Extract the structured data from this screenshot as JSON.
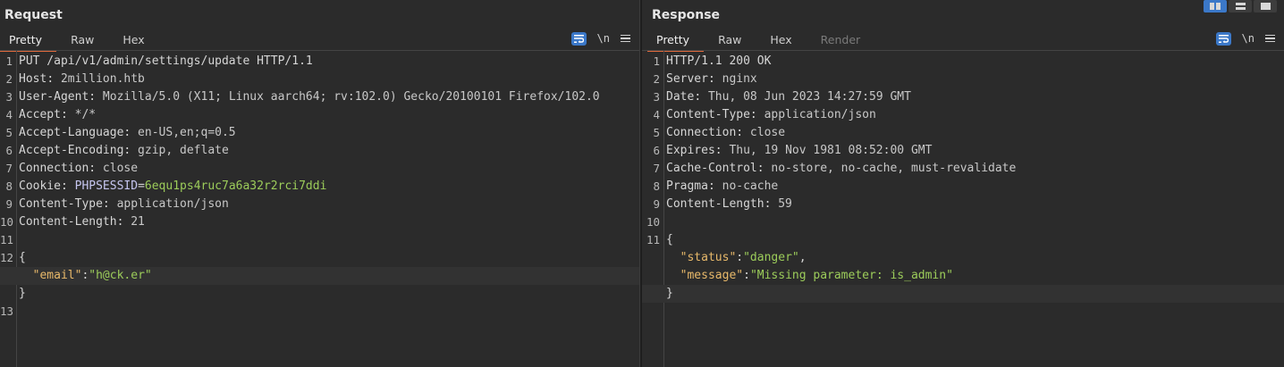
{
  "request": {
    "title": "Request",
    "tabs": [
      "Pretty",
      "Raw",
      "Hex"
    ],
    "toolbar": {
      "newline_label": "\\n"
    },
    "lines": [
      {
        "n": "1",
        "plain": "PUT /api/v1/admin/settings/update HTTP/1.1"
      },
      {
        "n": "2",
        "key": "Host",
        "val": " 2million.htb"
      },
      {
        "n": "3",
        "key": "User-Agent",
        "val": " Mozilla/5.0 (X11; Linux aarch64; rv:102.0) Gecko/20100101 Firefox/102.0"
      },
      {
        "n": "4",
        "key": "Accept",
        "val": " */*"
      },
      {
        "n": "5",
        "key": "Accept-Language",
        "val": " en-US,en;q=0.5"
      },
      {
        "n": "6",
        "key": "Accept-Encoding",
        "val": " gzip, deflate"
      },
      {
        "n": "7",
        "key": "Connection",
        "val": " close"
      },
      {
        "n": "8",
        "key": "Cookie",
        "cookie_name": "PHPSESSID",
        "cookie_value": "6equ1ps4ruc7a6a32r2rci7ddi"
      },
      {
        "n": "9",
        "key": "Content-Type",
        "val": " application/json"
      },
      {
        "n": "10",
        "key": "Content-Length",
        "val": " 21"
      },
      {
        "n": "11",
        "plain": ""
      },
      {
        "n": "12",
        "plain": "{"
      },
      {
        "n": "",
        "jkey": "\"email\"",
        "jval": "\"h@ck.er\"",
        "highlight": true,
        "indent": true
      },
      {
        "n": "",
        "plain": "}"
      },
      {
        "n": "13",
        "plain": ""
      }
    ]
  },
  "response": {
    "title": "Response",
    "tabs": [
      "Pretty",
      "Raw",
      "Hex",
      "Render"
    ],
    "toolbar": {
      "newline_label": "\\n"
    },
    "lines": [
      {
        "n": "1",
        "plain": "HTTP/1.1 200 OK"
      },
      {
        "n": "2",
        "key": "Server",
        "val": " nginx"
      },
      {
        "n": "3",
        "key": "Date",
        "val": " Thu, 08 Jun 2023 14:27:59 GMT"
      },
      {
        "n": "4",
        "key": "Content-Type",
        "val": " application/json"
      },
      {
        "n": "5",
        "key": "Connection",
        "val": " close"
      },
      {
        "n": "6",
        "key": "Expires",
        "val": " Thu, 19 Nov 1981 08:52:00 GMT"
      },
      {
        "n": "7",
        "key": "Cache-Control",
        "val": " no-store, no-cache, must-revalidate"
      },
      {
        "n": "8",
        "key": "Pragma",
        "val": " no-cache"
      },
      {
        "n": "9",
        "key": "Content-Length",
        "val": " 59"
      },
      {
        "n": "10",
        "plain": ""
      },
      {
        "n": "11",
        "plain": "{"
      },
      {
        "n": "",
        "jkey": "\"status\"",
        "jval": "\"danger\"",
        "trail": ",",
        "indent": true
      },
      {
        "n": "",
        "jkey": "\"message\"",
        "jval": "\"Missing parameter: is_admin\"",
        "indent": true
      },
      {
        "n": "",
        "plain": "}",
        "highlight": true
      }
    ]
  },
  "colors": {
    "accent": "#3b78c8",
    "tab_underline": "#e06a3c",
    "json_key": "#e8b96a",
    "json_string": "#9ccc5a"
  }
}
